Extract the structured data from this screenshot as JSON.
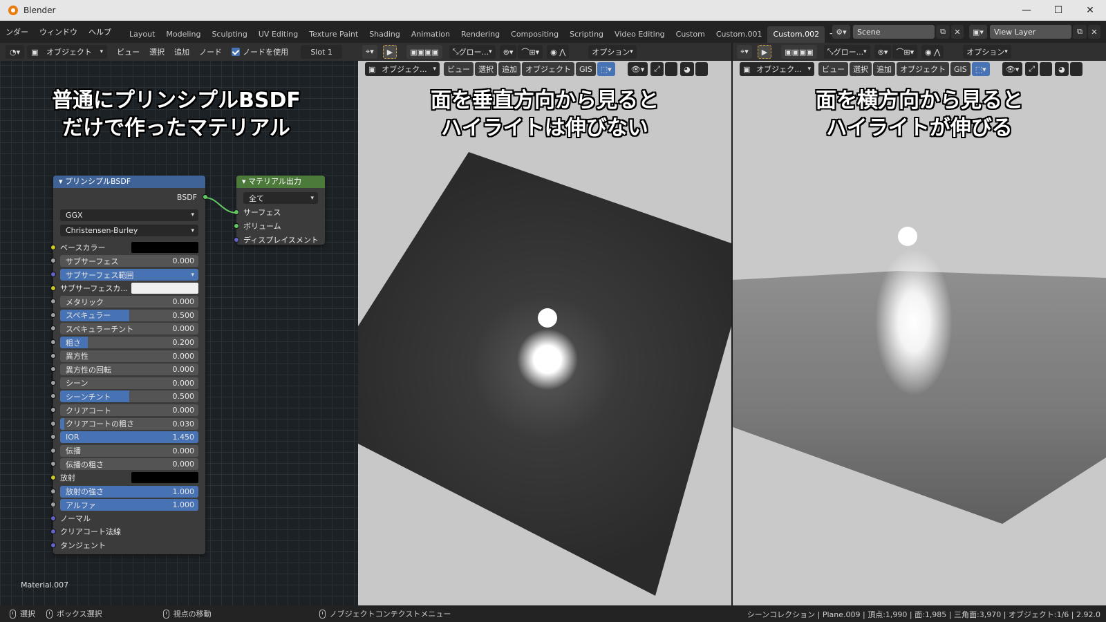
{
  "window": {
    "title": "Blender",
    "min": "—",
    "max": "☐",
    "close": "✕"
  },
  "topbar": {
    "menus": [
      "ンダー",
      "ウィンドウ",
      "ヘルプ"
    ],
    "tabs": [
      "Layout",
      "Modeling",
      "Sculpting",
      "UV Editing",
      "Texture Paint",
      "Shading",
      "Animation",
      "Rendering",
      "Compositing",
      "Scripting",
      "Video Editing",
      "Custom",
      "Custom.001",
      "Custom.002"
    ],
    "active_tab": "Custom.002",
    "scene": "Scene",
    "view_layer": "View Layer"
  },
  "node_editor": {
    "header": {
      "mode": "オブジェクト",
      "view": "ビュー",
      "select": "選択",
      "add": "追加",
      "node": "ノード",
      "use_nodes": "ノードを使用",
      "slot": "Slot 1"
    },
    "overlay_text": [
      "普通にプリンシプルBSDF",
      "だけで作ったマテリアル"
    ],
    "material_name": "Material.007",
    "bsdf_node": {
      "title": "プリンシプルBSDF",
      "output": "BSDF",
      "distribution": "GGX",
      "subsurface_method": "Christensen-Burley",
      "base_color_label": "ベースカラー",
      "subsurface_radius": "サブサーフェス範囲",
      "subsurface_color_label": "サブサーフェスカ...",
      "emission_label": "放射",
      "fields": [
        {
          "label": "サブサーフェス",
          "value": "0.000",
          "fill": 0
        },
        {
          "label": "メタリック",
          "value": "0.000",
          "fill": 0
        },
        {
          "label": "スペキュラー",
          "value": "0.500",
          "fill": 0.5
        },
        {
          "label": "スペキュラーチント",
          "value": "0.000",
          "fill": 0
        },
        {
          "label": "粗さ",
          "value": "0.200",
          "fill": 0.2
        },
        {
          "label": "異方性",
          "value": "0.000",
          "fill": 0
        },
        {
          "label": "異方性の回転",
          "value": "0.000",
          "fill": 0
        },
        {
          "label": "シーン",
          "value": "0.000",
          "fill": 0
        },
        {
          "label": "シーンチント",
          "value": "0.500",
          "fill": 0.5
        },
        {
          "label": "クリアコート",
          "value": "0.000",
          "fill": 0
        },
        {
          "label": "クリアコートの粗さ",
          "value": "0.030",
          "fill": 0.03
        },
        {
          "label": "IOR",
          "value": "1.450",
          "fill": 1
        },
        {
          "label": "伝播",
          "value": "0.000",
          "fill": 0
        },
        {
          "label": "伝播の粗さ",
          "value": "0.000",
          "fill": 0
        },
        {
          "label": "放射の強さ",
          "value": "1.000",
          "fill": 1
        },
        {
          "label": "アルファ",
          "value": "1.000",
          "fill": 1
        }
      ],
      "vector_inputs": [
        "ノーマル",
        "クリアコート法線",
        "タンジェント"
      ]
    },
    "output_node": {
      "title": "マテリアル出力",
      "target": "全て",
      "inputs": [
        "サーフェス",
        "ボリューム",
        "ディスプレイスメント"
      ]
    }
  },
  "viewport_left": {
    "overlay_text": [
      "面を垂直方向から見ると",
      "ハイライトは伸びない"
    ],
    "transform": "グロー...",
    "options": "オプション",
    "mode": "オブジェク...",
    "view": "ビュー",
    "select": "選択",
    "add": "追加",
    "object": "オブジェクト",
    "gis": "GIS"
  },
  "viewport_right": {
    "overlay_text": [
      "面を横方向から見ると",
      "ハイライトが伸びる"
    ],
    "transform": "グロー...",
    "options": "オプション",
    "mode": "オブジェク...",
    "view": "ビュー",
    "select": "選択",
    "add": "追加",
    "object": "オブジェクト",
    "gis": "GIS"
  },
  "statusbar": {
    "select": "選択",
    "box_select": "ボックス選択",
    "move_view": "視点の移動",
    "context_menu": "ノブジェクトコンテクストメニュー",
    "stats": "シーンコレクション | Plane.009 | 頂点:1,990 | 面:1,985 | 三角面:3,970 | オブジェクト:1/6 | 2.92.0"
  },
  "colors": {
    "accent": "#4772b3",
    "bsdf_header": "#3f6397",
    "output_header": "#4c7a3a"
  }
}
